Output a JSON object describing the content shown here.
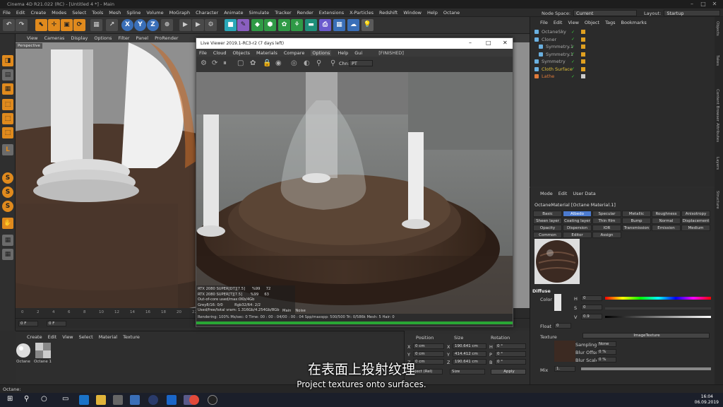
{
  "window": {
    "title": "Cinema 4D R21.022 (RC) - [Untitled 4 *] - Main"
  },
  "menubar": {
    "items": [
      "File",
      "Edit",
      "Create",
      "Modes",
      "Select",
      "Tools",
      "Mesh",
      "Spline",
      "Volume",
      "MoGraph",
      "Character",
      "Animate",
      "Simulate",
      "Tracker",
      "Render",
      "Extensions",
      "X-Particles",
      "Redshift",
      "Window",
      "Help",
      "Octane"
    ],
    "node_space_label": "Node Space:",
    "node_space_value": "Current (Standard/Physical)",
    "layout_label": "Layout:",
    "layout_value": "Startup"
  },
  "toolbar": {
    "x": "X",
    "y": "Y",
    "z": "Z"
  },
  "viewport": {
    "menu": [
      "View",
      "Cameras",
      "Display",
      "Options",
      "Filter",
      "Panel",
      "ProRender"
    ],
    "badge": "Perspective"
  },
  "live_viewer": {
    "title": "Live Viewer 2019.1-RC3-r2 (7 days left)",
    "menu": [
      "File",
      "Cloud",
      "Objects",
      "Materials",
      "Compare",
      "Options",
      "Help",
      "Gui"
    ],
    "state": "[FINISHED]",
    "channel_label": "Chn:",
    "channel_value": "PT",
    "info": [
      "RTX 2080 SUPER[DT][7.5]      %99     72",
      "RTX 2080 SUPER[T][7.5]       %99     63",
      "Out-of-core used/max:0Kb/4Gb",
      "Grey8/16: 0/0          Rgb32/64: 2/2",
      "Used/free/total vram: 1.316Gb/4.254Gb/8Gb"
    ],
    "tabs": [
      "Main",
      "Noise"
    ],
    "status": "Rendering: 100%  Ms/sec: 0    Time: 00 : 00 : 04/00 : 00 : 04   Spp/maxspp: 500/500   Tri: 0/586k   Mesh: 5   Hair: 0",
    "progress": 100
  },
  "timeline": {
    "ticks": [
      "0",
      "2",
      "4",
      "6",
      "8",
      "10",
      "12",
      "14",
      "16",
      "18",
      "20",
      "22",
      "24",
      "26",
      "28",
      "30"
    ],
    "start": "0 F",
    "end": "0 F"
  },
  "material_manager": {
    "menu": [
      "Create",
      "Edit",
      "View",
      "Select",
      "Material",
      "Texture"
    ],
    "materials": [
      "Octane",
      "Octane 1"
    ]
  },
  "coords": {
    "headers": [
      "Position",
      "Size",
      "Rotation"
    ],
    "rows": [
      {
        "axis": "X",
        "pos": "0 cm",
        "size": "190.641 cm",
        "rlabel": "H",
        "rot": "0 °"
      },
      {
        "axis": "Y",
        "pos": "0 cm",
        "size": "414.412 cm",
        "rlabel": "P",
        "rot": "0 °"
      },
      {
        "axis": "Z",
        "pos": "0 cm",
        "size": "190.641 cm",
        "rlabel": "B",
        "rot": "0 °"
      }
    ],
    "object_mode": "Object (Rel)",
    "size_mode": "Size",
    "apply": "Apply"
  },
  "object_manager": {
    "menu": [
      "File",
      "Edit",
      "View",
      "Object",
      "Tags",
      "Bookmarks"
    ],
    "objects": [
      {
        "name": "OctaneSky",
        "color": "#aaaaaa"
      },
      {
        "name": "Cloner",
        "color": "#aaaaaa"
      },
      {
        "name": "Symmetry.1",
        "color": "#aaaaaa"
      },
      {
        "name": "Symmetry.1",
        "color": "#aaaaaa"
      },
      {
        "name": "Symmetry",
        "color": "#aaaaaa"
      },
      {
        "name": "Cloth Surface",
        "color": "#e0c03a"
      },
      {
        "name": "Lathe",
        "color": "#e07a3a"
      }
    ]
  },
  "attributes": {
    "menu": [
      "Mode",
      "Edit",
      "User Data"
    ],
    "title": "OctaneMaterial [Octane Material.1]",
    "tabs": [
      [
        "Basic",
        "Albedo",
        "Specular",
        "Metallic",
        "Roughness",
        "Anisotropy"
      ],
      [
        "Sheen layer",
        "Coating layer",
        "Thin film layer",
        "Bump",
        "Normal",
        "Displacement"
      ],
      [
        "Opacity",
        "Dispersion",
        "IOR",
        "Transmission",
        "Emission",
        "Medium"
      ],
      [
        "Common",
        "Editor",
        "Assign"
      ]
    ],
    "active_tab": "Albedo",
    "section": "Diffuse",
    "color_label": "Color",
    "hsv": [
      {
        "l": "H",
        "v": "0"
      },
      {
        "l": "S",
        "v": "0"
      },
      {
        "l": "V",
        "v": "0.9"
      }
    ],
    "float_label": "Float",
    "float_value": "0",
    "texture_label": "Texture",
    "texture_button": "ImageTexture",
    "sampling_label": "Sampling",
    "sampling_value": "None",
    "blur_offset_label": "Blur Offset",
    "blur_offset_value": "0 %",
    "blur_scale_label": "Blur Scale",
    "blur_scale_value": "0 %",
    "mix_label": "Mix",
    "mix_value": "1."
  },
  "side_tabs": [
    "Objects",
    "Takes",
    "Content Browser",
    "Attributes",
    "Layers",
    "Structure"
  ],
  "status_bar": {
    "text": "Octane:"
  },
  "taskbar": {
    "time": "16:04",
    "date": "06.09.2019"
  },
  "subtitle": {
    "cn": "在表面上投射纹理",
    "en": "Project textures onto surfaces."
  },
  "colors": {
    "accent": "#4c7bd0",
    "progress": "#29a635",
    "check": "#3ad13a"
  }
}
